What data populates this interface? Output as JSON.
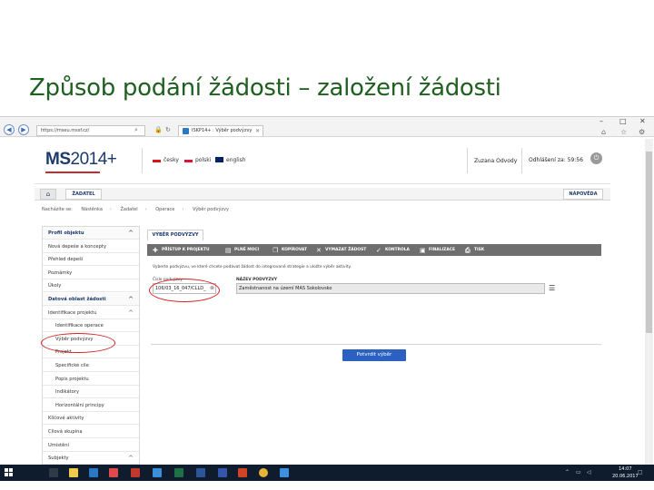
{
  "slide": {
    "title": "Způsob podání žádosti – založení žádosti"
  },
  "browser": {
    "address": "https://mseu.mssf.cz/",
    "tab_title": "ISKP14+ : Výběr podvýzvy"
  },
  "app": {
    "logo_text": "MS",
    "logo_num": "2014+",
    "languages": [
      "česky",
      "polski",
      "english"
    ],
    "user": "Zuzana Odvody",
    "logout": "Odhlášení za: 59:56",
    "menu": {
      "zadatel": "ŽADATEL",
      "help": "NÁPOVĚDA"
    },
    "breadcrumbs": [
      "Nacházíte se:",
      "Nástěnka",
      "Žadatel",
      "Operace",
      "Výběr podvýzvy"
    ]
  },
  "sidebar": {
    "items": [
      {
        "label": "Profil objektu",
        "type": "head",
        "chev": "^"
      },
      {
        "label": "Nová depeše a koncepty",
        "type": "item"
      },
      {
        "label": "Přehled depeší",
        "type": "item"
      },
      {
        "label": "Poznámky",
        "type": "item"
      },
      {
        "label": "Úkoly",
        "type": "item"
      },
      {
        "label": "Datová oblast žádosti",
        "type": "head",
        "chev": "^"
      },
      {
        "label": "Identifikace projektu",
        "type": "item",
        "chev": "^"
      },
      {
        "label": "Identifikace operace",
        "type": "sub"
      },
      {
        "label": "Výběr podvýzvy",
        "type": "sub"
      },
      {
        "label": "Projekt",
        "type": "sub"
      },
      {
        "label": "Specifické cíle",
        "type": "sub"
      },
      {
        "label": "Popis projektu",
        "type": "sub"
      },
      {
        "label": "Indikátory",
        "type": "sub"
      },
      {
        "label": "Horizontální principy",
        "type": "sub"
      },
      {
        "label": "Klíčové aktivity",
        "type": "item"
      },
      {
        "label": "Cílová skupina",
        "type": "item"
      },
      {
        "label": "Umístění",
        "type": "item"
      },
      {
        "label": "Subjekty",
        "type": "item",
        "chev": "^"
      }
    ]
  },
  "main": {
    "tab": "VÝBĚR PODVÝZVY",
    "toolbar": [
      {
        "icon": "access-icon",
        "glyph": "✚",
        "label": "PŘÍSTUP K PROJEKTU"
      },
      {
        "icon": "plna-moc-icon",
        "glyph": "▤",
        "label": "PLNÉ MOCI"
      },
      {
        "icon": "copy-icon",
        "glyph": "❐",
        "label": "KOPÍROVAT"
      },
      {
        "icon": "delete-icon",
        "glyph": "✕",
        "label": "VYMAZAT ŽÁDOST"
      },
      {
        "icon": "check-icon",
        "glyph": "✓",
        "label": "KONTROLA"
      },
      {
        "icon": "finalize-icon",
        "glyph": "▣",
        "label": "FINALIZACE"
      },
      {
        "icon": "print-icon",
        "glyph": "⎙",
        "label": "TISK"
      }
    ],
    "intro": "Vyberte podvýzvu, ve které chcete podávat žádost do integrované strategie a uložte výběr aktivity.",
    "label_cislo": "Číslo podvýzvy",
    "label_nazev": "NÁZEV PODVÝZVY",
    "value_cislo": "106/03_16_047/CLLD_",
    "value_nazev": "Zaměstnanost na území MAS Sokolovsko",
    "confirm": "Potvrdit výběr"
  },
  "taskbar": {
    "time": "14:07",
    "date": "20.06.2017"
  },
  "colors": {
    "title": "#1f5f1f",
    "highlight": "#d61f1f",
    "primary_button": "#2b62c1",
    "toolbar": "#6e6e6e",
    "taskbar": "#0f1c2e"
  }
}
